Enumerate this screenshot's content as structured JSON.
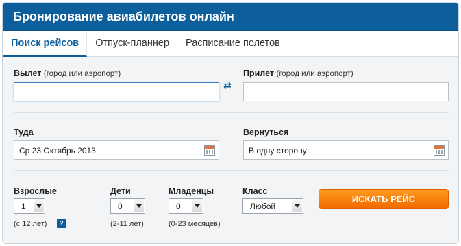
{
  "header": {
    "title": "Бронирование авиабилетов онлайн"
  },
  "tabs": [
    {
      "label": "Поиск рейсов",
      "active": true
    },
    {
      "label": "Отпуск-планнер",
      "active": false
    },
    {
      "label": "Расписание полетов",
      "active": false
    }
  ],
  "from": {
    "label": "Вылет",
    "hint": "(город или аэропорт)",
    "value": ""
  },
  "to": {
    "label": "Прилет",
    "hint": "(город или аэропорт)",
    "value": ""
  },
  "swap_icon": "swap-arrows-icon",
  "depart": {
    "label": "Туда",
    "value": "Ср 23 Октябрь 2013",
    "icon": "calendar-icon"
  },
  "return": {
    "label": "Вернуться",
    "value": "В одну сторону",
    "icon": "calendar-icon"
  },
  "adults": {
    "label": "Взрослые",
    "value": "1",
    "note": "(с 12 лет)"
  },
  "children": {
    "label": "Дети",
    "value": "0",
    "note": "(2-11 лет)"
  },
  "infants": {
    "label": "Младенцы",
    "value": "0",
    "note": "(0-23 месяцев)"
  },
  "class": {
    "label": "Класс",
    "value": "Любой"
  },
  "help_label": "?",
  "search_button": "ИСКАТЬ РЕЙС",
  "colors": {
    "brand": "#0d5f9b",
    "button": "#f57c00"
  }
}
